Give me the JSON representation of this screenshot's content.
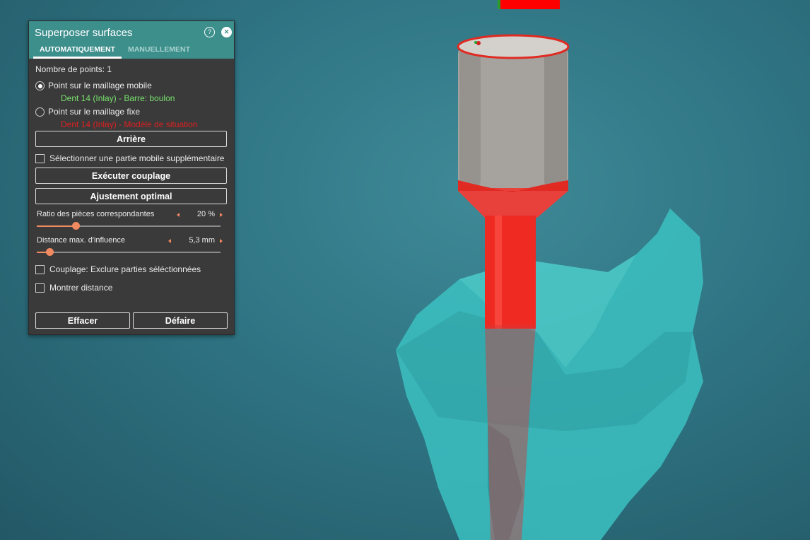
{
  "panel": {
    "title": "Superposer surfaces",
    "tabs": [
      {
        "label": "AUTOMATIQUEMENT",
        "active": true
      },
      {
        "label": "MANUELLEMENT",
        "active": false
      }
    ],
    "point_count": "Nombre de points: 1",
    "radio_mobile": {
      "label": "Point sur le maillage mobile",
      "sub": "Dent 14 (Inlay) - Barre: boulon",
      "checked": true,
      "color": "#78e06c"
    },
    "radio_fixed": {
      "label": "Point sur le maillage fixe",
      "sub": "Dent 14 (Inlay) - Modèle de situation",
      "checked": false,
      "color": "#e02020"
    },
    "back_button": "Arrière",
    "extra_mobile_checkbox": {
      "label": "Sélectionner une partie mobile supplémentaire",
      "checked": false
    },
    "execute_button": "Exécuter couplage",
    "bestfit_button": "Ajustement optimal",
    "ratio_slider": {
      "label": "Ratio des pièces correspondantes",
      "value": "20 %",
      "fraction": 0.21
    },
    "distance_slider": {
      "label": "Distance max. d'influence",
      "value": "5,3 mm",
      "fraction": 0.07
    },
    "exclude_checkbox": {
      "label": "Couplage: Exclure parties séléctionnées",
      "checked": false
    },
    "show_distance_checkbox": {
      "label": "Montrer distance",
      "checked": false
    },
    "clear_button": "Effacer",
    "undo_button": "Défaire"
  },
  "colors": {
    "header": "#3d8f8c",
    "panel": "#3a3a3a",
    "accent": "#f08a60",
    "background": "#2f7483"
  }
}
